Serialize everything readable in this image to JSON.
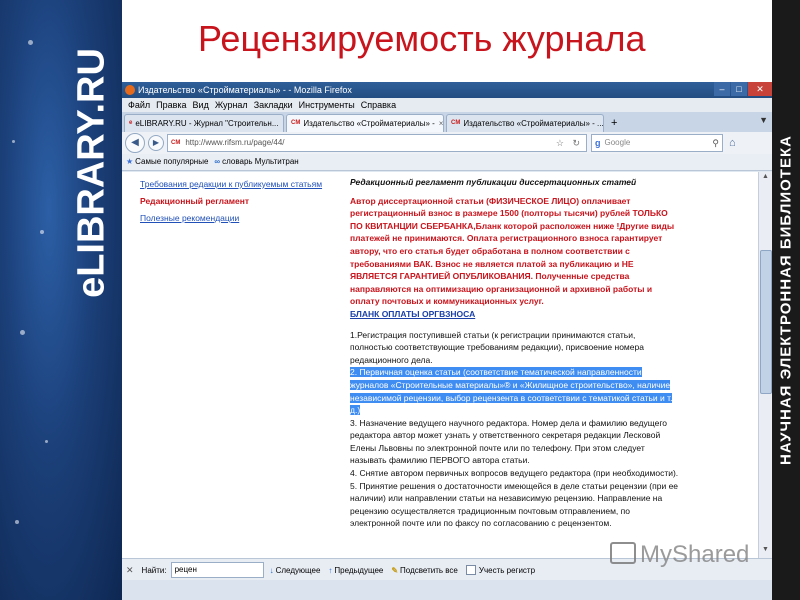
{
  "slide": {
    "title": "Рецензируемость журнала",
    "left_logo": "eLIBRARY.RU",
    "right_text": "НАУЧНАЯ ЭЛЕКТРОННАЯ БИБЛИОТЕКА"
  },
  "browser": {
    "window_title": "Издательство «Стройматериалы» - - Mozilla Firefox",
    "menu": [
      "Файл",
      "Правка",
      "Вид",
      "Журнал",
      "Закладки",
      "Инструменты",
      "Справка"
    ],
    "tabs": [
      {
        "label": "eLIBRARY.RU - Журнал \"Строительн...",
        "active": false
      },
      {
        "label": "Издательство «Стройматериалы» -",
        "active": true
      },
      {
        "label": "Издательство «Стройматериалы» - ...",
        "active": false
      }
    ],
    "url": "http://www.rifsm.ru/page/44/",
    "search_placeholder": "Google",
    "bookmarks": [
      "Самые популярные",
      "словарь Мультитран"
    ],
    "findbar": {
      "label": "Найти:",
      "value": "рецен",
      "next": "Следующее",
      "prev": "Предыдущее",
      "highlight_all": "Подсветить все",
      "match_case": "Учесть регистр"
    }
  },
  "page": {
    "leftnav": {
      "link1": "Требования редакции к публикуемым статьям",
      "current": "Редакционный регламент",
      "link2": "Полезные рекомендации"
    },
    "article": {
      "heading": "Редакционный регламент публикации диссертационных статей",
      "red_notice": "Автор диссертационной статьи (ФИЗИЧЕСКОЕ ЛИЦО) оплачивает регистрационный взнос в размере 1500 (полторы тысячи) рублей ТОЛЬКО ПО КВИТАНЦИИ СБЕРБАНКА,Бланк которой расположен ниже !Другие виды платежей не принимаются. Оплата регистрационного взноса гарантирует автору, что его статья будет обработана в полном соответствии с требованиями ВАК. Взнос не является платой за публикацию и НЕ ЯВЛЯЕТСЯ ГАРАНТИЕЙ ОПУБЛИКОВАНИЯ. Полученные средства направляются на оптимизацию организационной и архивной работы и оплату почтовых и коммуникационных услуг.",
      "blank_link": "БЛАНК ОПЛАТЫ ОРГВЗНОСА",
      "item1": "1.Регистрация поступившей статьи (к регистрации принимаются статьи, полностью соответствующие требованиям редакции), присвоение номера редакционного дела.",
      "item2": "2. Первичная оценка статьи (соответствие тематической направленности журналов «Строительные материалы»® и «Жилищное строительство», наличие независимой рецензии, выбор рецензента в соответствии с тематикой статьи и т. д.)",
      "item3": "3. Назначение ведущего научного редактора. Номер дела и фамилию ведущего редактора автор может узнать у ответственного секретаря редакции Лесковой Елены Львовны по электронной почте или по телефону. При этом следует называть фамилию ПЕРВОГО автора статьи.",
      "item4": "4. Снятие автором первичных вопросов ведущего редактора (при необходимости).",
      "item5": "5. Принятие решения о достаточности имеющейся в деле статьи рецензии (при ее наличии) или направлении статьи на независимую рецензию. Направление на рецензию осуществляется традиционным почтовым отправлением, по электронной почте или по факсу по согласованию с рецензентом."
    }
  },
  "watermark": "MyShared",
  "colors": {
    "title_red": "#c8141c",
    "highlight": "#3f8df2",
    "link_blue": "#2050b8"
  }
}
